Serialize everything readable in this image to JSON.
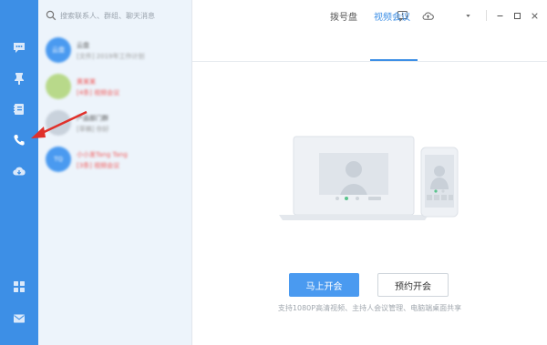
{
  "search": {
    "placeholder": "搜索联系人、群组、聊天消息"
  },
  "sidebar": {
    "items": [
      {
        "name": "chat-icon"
      },
      {
        "name": "pin-icon"
      },
      {
        "name": "contacts-book-icon"
      },
      {
        "name": "phone-icon"
      },
      {
        "name": "cloud-drive-icon"
      },
      {
        "name": "apps-grid-icon"
      },
      {
        "name": "mail-icon"
      }
    ],
    "accent": "#3d8fe6"
  },
  "contacts": [
    {
      "avatar_text": "云盘",
      "avatar_color": "#4a9af0",
      "name": "云盘",
      "message": "[文件] 2019年工作计划",
      "alert": false
    },
    {
      "avatar_text": "",
      "avatar_color": "#b8d98a",
      "name": "黄某某",
      "message": "[4条] 视频会议",
      "alert": true
    },
    {
      "avatar_text": "",
      "avatar_color": "#c9d2dc",
      "name": "产品部门群",
      "message": "[草稿] 你好",
      "alert": false
    },
    {
      "avatar_text": "TQ",
      "avatar_color": "#4a9af0",
      "name": "小小发Tang Tang",
      "message": "[3条] 视频会议",
      "alert": true
    }
  ],
  "toolbar": {
    "icons": [
      "feedback-icon",
      "cloud-upload-icon",
      "dropdown-caret-icon",
      "minimize-icon",
      "maximize-icon",
      "close-icon"
    ]
  },
  "main": {
    "tabs": [
      {
        "label": "拨号盘",
        "active": false
      },
      {
        "label": "视频会议",
        "active": true
      }
    ],
    "start_button": "马上开会",
    "schedule_button": "预约开会",
    "feature_text": "支持1080P高清视频、主持人会议管理、电脑端桌面共享"
  },
  "colors": {
    "primary_button": "#4a9af0",
    "alert_text": "#f05a5a",
    "annotation_arrow": "#e0302a"
  }
}
